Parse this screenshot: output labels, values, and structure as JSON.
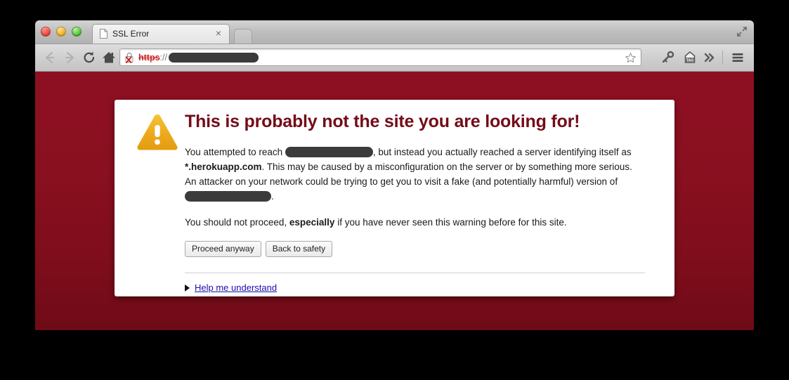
{
  "window": {
    "traffic_lights": [
      "close",
      "minimize",
      "zoom"
    ],
    "fullscreen_icon": "fullscreen-arrows-icon"
  },
  "tab_strip": {
    "tab": {
      "favicon": "page-icon",
      "title": "SSL Error",
      "close_label": "×"
    },
    "new_tab_label": ""
  },
  "toolbar": {
    "back_icon": "arrow-left-icon",
    "forward_icon": "arrow-right-icon",
    "reload_icon": "reload-icon",
    "home_icon": "home-icon",
    "omnibox": {
      "security_icon": "broken-lock-icon",
      "scheme": "https",
      "separator": "://",
      "host_redacted": true
    },
    "bookmark_icon": "star-icon",
    "extension_icons": [
      "wrench-key-icon",
      "tag-icon"
    ],
    "overflow_icon": "chevron-double-right-icon",
    "overflow_label": "»",
    "tag_label": "TAG",
    "menu_icon": "hamburger-menu-icon"
  },
  "interstitial": {
    "icon": "warning-triangle-icon",
    "headline": "This is probably not the site you are looking for!",
    "paragraph1": {
      "pre": "You attempted to reach",
      "mid": ", but instead you actually reached a server identifying itself as",
      "server_name": "*.herokuapp.com",
      "post": ". This may be caused by a misconfiguration on the server or by something more serious. An attacker on your network could be trying to get you to visit a fake (and potentially harmful) version of",
      "end": "."
    },
    "paragraph2": {
      "pre": "You should not proceed,",
      "emphasis": "especially",
      "post": "if you have never seen this warning before for this site."
    },
    "buttons": {
      "proceed": "Proceed anyway",
      "back": "Back to safety"
    },
    "expander": {
      "triangle": "disclosure-triangle-right",
      "link_text": "Help me understand"
    }
  },
  "colors": {
    "page_background_top": "#8d1022",
    "page_background_bottom": "#6e0b17",
    "headline": "#730c18",
    "warning_amber": "#efa91f",
    "link_blue": "#1a0dab",
    "scheme_red": "#cc2222",
    "redaction": "#3b3b3b"
  }
}
